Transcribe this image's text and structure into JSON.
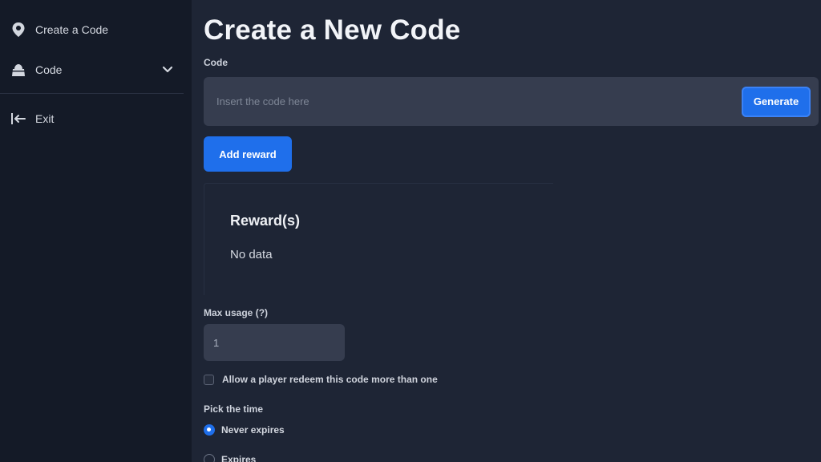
{
  "sidebar": {
    "items": [
      {
        "label": "Create a Code",
        "icon": "map-pin-icon"
      },
      {
        "label": "Code",
        "icon": "gift-icon",
        "has_dropdown": true
      },
      {
        "label": "Exit",
        "icon": "exit-icon"
      }
    ]
  },
  "main": {
    "title": "Create a New Code",
    "code_label": "Code",
    "code_placeholder": "Insert the code here",
    "generate_label": "Generate",
    "add_reward_label": "Add reward",
    "rewards": {
      "title": "Reward(s)",
      "empty_text": "No data"
    },
    "max_usage_label": "Max usage (?)",
    "max_usage_value": "1",
    "allow_redeem_label": "Allow a player redeem this code more than one",
    "allow_redeem_checked": false,
    "time_label": "Pick the time",
    "time_options": [
      {
        "label": "Never expires",
        "checked": true
      },
      {
        "label": "Expires",
        "checked": false
      }
    ]
  },
  "colors": {
    "sidebar_bg": "#141a27",
    "main_bg": "#1e2535",
    "input_bg": "#363d4f",
    "accent": "#1f6feb"
  }
}
